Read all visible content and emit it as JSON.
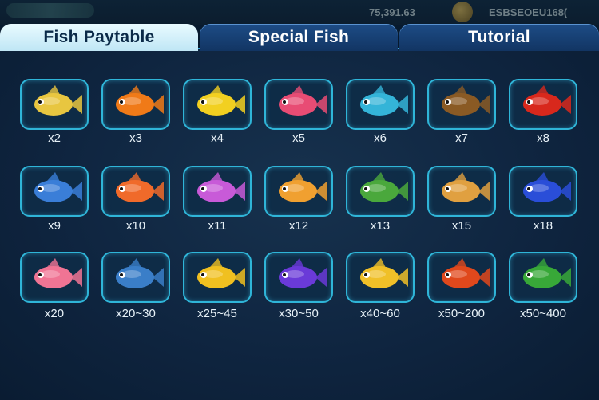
{
  "header": {
    "balance": "75,391.63",
    "user_id": "ESBSEOEU168("
  },
  "tabs": [
    {
      "label": "Fish Paytable",
      "active": true
    },
    {
      "label": "Special Fish",
      "active": false
    },
    {
      "label": "Tutorial",
      "active": false
    }
  ],
  "fish": [
    {
      "name": "flying-fish",
      "mult": "x2",
      "color": "#e8c640"
    },
    {
      "name": "clownfish",
      "mult": "x3",
      "color": "#f07a18"
    },
    {
      "name": "angelfish",
      "mult": "x4",
      "color": "#f2d020"
    },
    {
      "name": "pufferfish",
      "mult": "x5",
      "color": "#e84c74"
    },
    {
      "name": "mandarin-fish",
      "mult": "x6",
      "color": "#34b4d8"
    },
    {
      "name": "flounder",
      "mult": "x7",
      "color": "#8a5a24"
    },
    {
      "name": "lobster",
      "mult": "x8",
      "color": "#d8281c"
    },
    {
      "name": "swordfish",
      "mult": "x9",
      "color": "#3a7ed8"
    },
    {
      "name": "octopus",
      "mult": "x10",
      "color": "#f06a2a"
    },
    {
      "name": "jellyfish",
      "mult": "x11",
      "color": "#c85ad8"
    },
    {
      "name": "anglerfish",
      "mult": "x12",
      "color": "#f0a030"
    },
    {
      "name": "sea-turtle",
      "mult": "x13",
      "color": "#4aa83c"
    },
    {
      "name": "sawfish",
      "mult": "x15",
      "color": "#e0a040"
    },
    {
      "name": "manta-ray",
      "mult": "x18",
      "color": "#2a4ed8"
    },
    {
      "name": "pink-pufferfish",
      "mult": "x20",
      "color": "#f07494"
    },
    {
      "name": "shark",
      "mult": "x20~30",
      "color": "#3a7ec8"
    },
    {
      "name": "golden-shark",
      "mult": "x25~45",
      "color": "#f0c020"
    },
    {
      "name": "purple-dragon-fish",
      "mult": "x30~50",
      "color": "#6a3ad8"
    },
    {
      "name": "golden-dolphin",
      "mult": "x40~60",
      "color": "#f0c028"
    },
    {
      "name": "crab",
      "mult": "x50~200",
      "color": "#e0481c"
    },
    {
      "name": "golden-toad",
      "mult": "x50~400",
      "color": "#38a838"
    }
  ]
}
